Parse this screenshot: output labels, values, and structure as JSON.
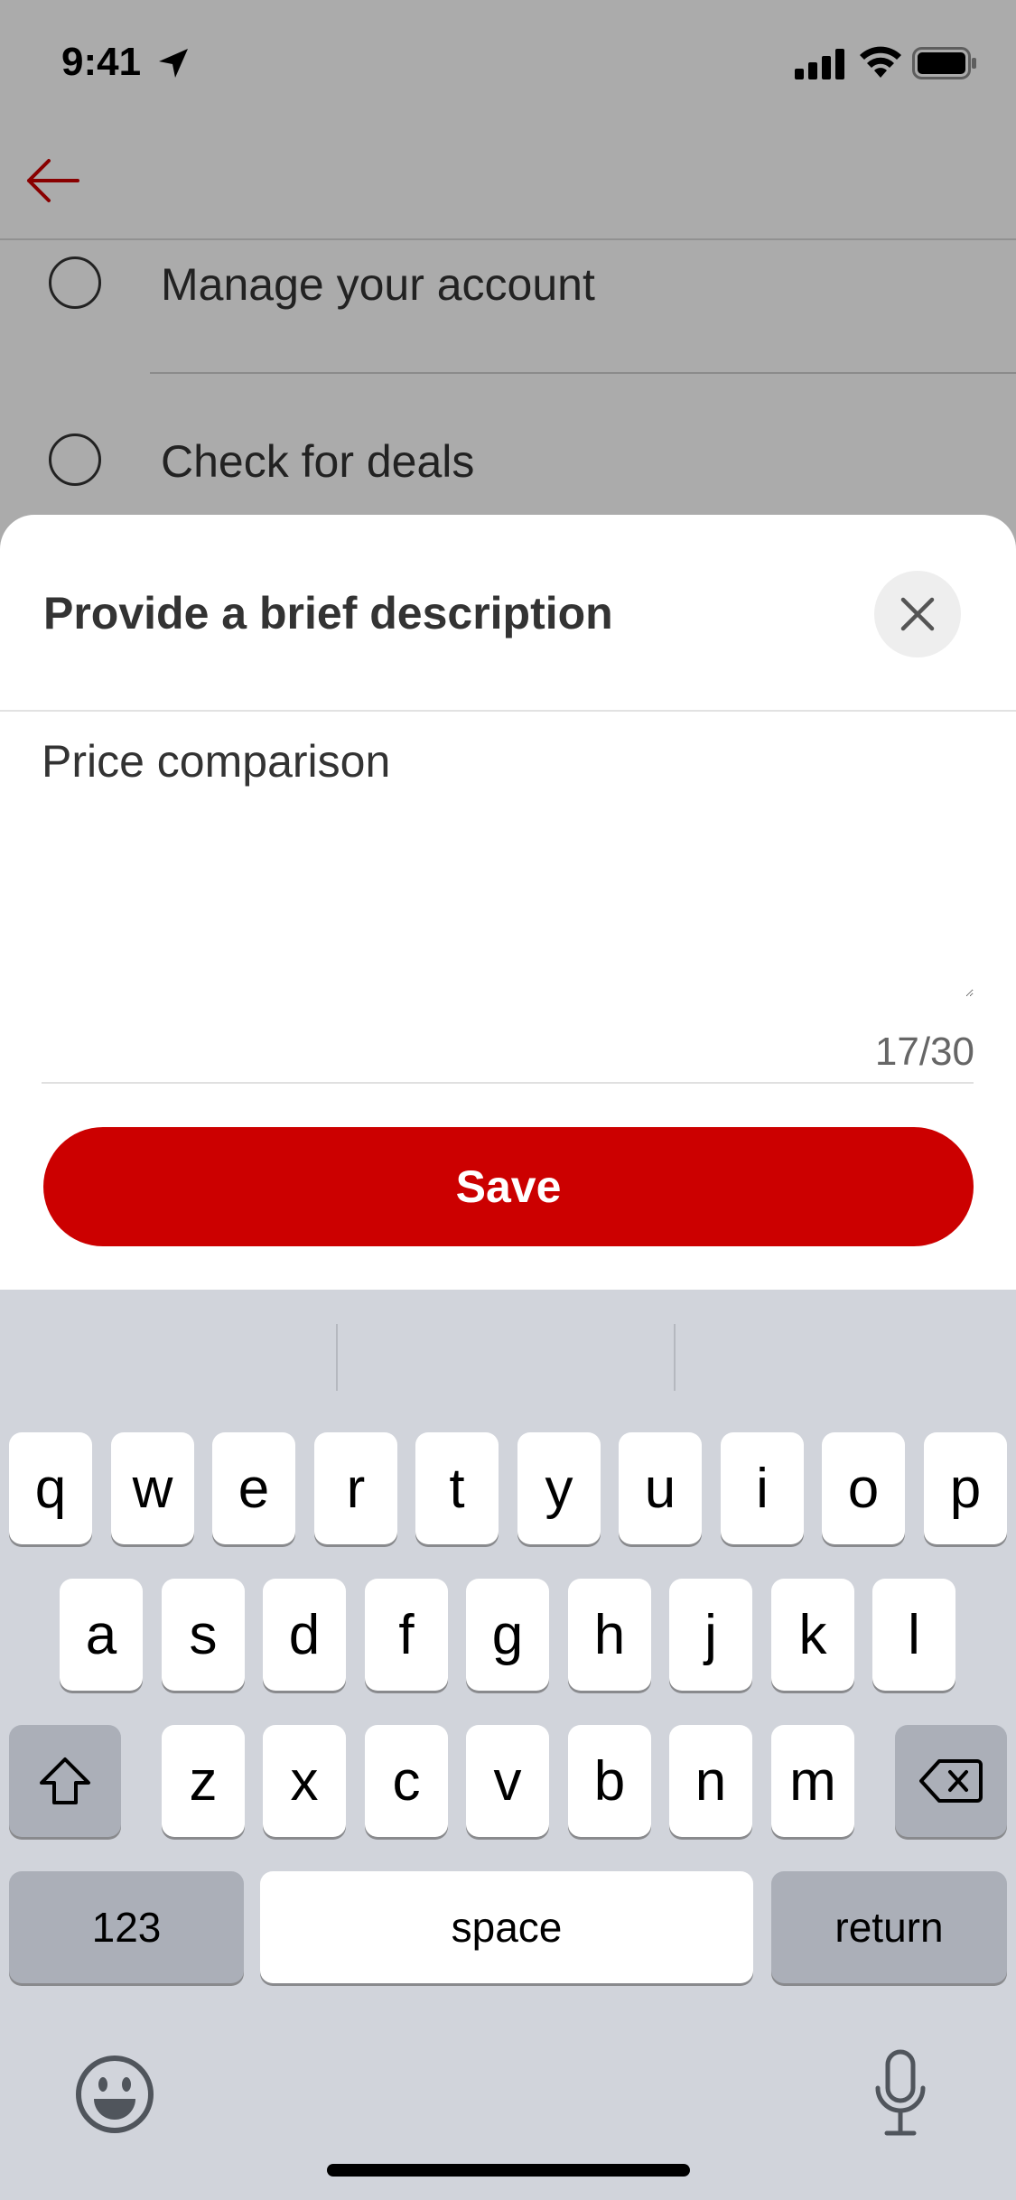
{
  "status_bar": {
    "time": "9:41",
    "icons": [
      "location-arrow-icon",
      "cellular-signal-icon",
      "wifi-icon",
      "battery-icon"
    ]
  },
  "nav": {
    "back_icon": "back-arrow-icon",
    "accent_color": "#cc0000"
  },
  "background_list": {
    "items": [
      {
        "label": "Manage your account"
      },
      {
        "label": "Check for deals"
      }
    ]
  },
  "sheet": {
    "title": "Provide a brief description",
    "close_icon": "close-icon",
    "description_value": "Price comparison",
    "counter": "17/30",
    "save_label": "Save",
    "save_color": "#cc0000"
  },
  "keyboard": {
    "row1": [
      "q",
      "w",
      "e",
      "r",
      "t",
      "y",
      "u",
      "i",
      "o",
      "p"
    ],
    "row2": [
      "a",
      "s",
      "d",
      "f",
      "g",
      "h",
      "j",
      "k",
      "l"
    ],
    "row3": [
      "z",
      "x",
      "c",
      "v",
      "b",
      "n",
      "m"
    ],
    "shift_icon": "shift-icon",
    "delete_icon": "delete-icon",
    "numbers_label": "123",
    "space_label": "space",
    "return_label": "return",
    "emoji_icon": "emoji-icon",
    "mic_icon": "microphone-icon"
  }
}
